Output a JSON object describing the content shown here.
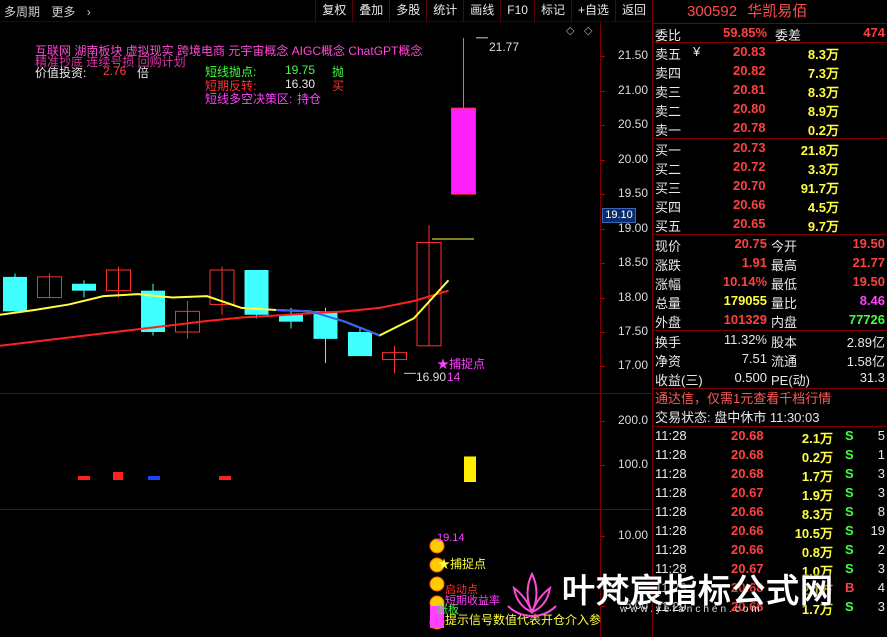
{
  "toolbar": {
    "period": "多周期",
    "more": "更多",
    "buttons": [
      "复权",
      "叠加",
      "多股",
      "统计",
      "画线",
      "F10",
      "标记",
      "+自选",
      "返回"
    ]
  },
  "overlay": {
    "concepts": "互联网    湖南板块    虚拟现实 跨境电商 元宇宙概念 AIGC概念 ChatGPT概念",
    "garbled_line": "精准抄底 连续号损 回购计划",
    "value_invest_label": "价值投资:",
    "value_invest_value": "2.76",
    "value_invest_unit": "倍",
    "short_sell_label": "短线抛点:",
    "short_sell_value": "19.75",
    "short_sell_tag": "抛",
    "short_reverse_label": "短期反转:",
    "short_reverse_value": "16.30",
    "short_reverse_tag": "买",
    "decision_label": "短线多空决策区:",
    "decision_value": "持仓",
    "high_mark": "21.77",
    "low_mark": "16.90",
    "capture_label": "捕捉点",
    "capture_value": "14",
    "price_tag": "19.10"
  },
  "axes": {
    "main_ticks": [
      "21.50",
      "21.00",
      "20.50",
      "20.00",
      "19.50",
      "19.00",
      "18.50",
      "18.00",
      "17.50",
      "17.00"
    ],
    "vol_ticks": [
      "200.0",
      "100.0"
    ],
    "sig_ticks": [
      "10.00",
      "5.00"
    ]
  },
  "signal_pane": {
    "value": "19.14",
    "capture_label": "捕捉点",
    "item2": "启动点",
    "item3": "短期收益率",
    "item4": "涨板",
    "hint": "提示信号数值代表开仓介入参"
  },
  "chart_data": {
    "type": "candlestick",
    "ylim": [
      16.6,
      22.0
    ],
    "candles": [
      {
        "o": 18.3,
        "c": 17.8,
        "h": 18.35,
        "l": 17.8
      },
      {
        "o": 18.0,
        "c": 18.3,
        "h": 18.35,
        "l": 18.0
      },
      {
        "o": 18.2,
        "c": 18.1,
        "h": 18.25,
        "l": 18.0
      },
      {
        "o": 18.1,
        "c": 18.4,
        "h": 18.45,
        "l": 18.0
      },
      {
        "o": 18.1,
        "c": 17.5,
        "h": 18.2,
        "l": 17.45
      },
      {
        "o": 17.5,
        "c": 17.8,
        "h": 17.95,
        "l": 17.4
      },
      {
        "o": 17.9,
        "c": 18.4,
        "h": 18.45,
        "l": 17.75
      },
      {
        "o": 18.4,
        "c": 17.75,
        "h": 18.4,
        "l": 17.7
      },
      {
        "o": 17.75,
        "c": 17.65,
        "h": 17.85,
        "l": 17.55
      },
      {
        "o": 17.8,
        "c": 17.4,
        "h": 17.85,
        "l": 17.05
      },
      {
        "o": 17.5,
        "c": 17.15,
        "h": 17.55,
        "l": 17.15
      },
      {
        "o": 17.1,
        "c": 17.2,
        "h": 17.3,
        "l": 16.9
      },
      {
        "o": 17.3,
        "c": 18.8,
        "h": 19.05,
        "l": 17.3
      },
      {
        "o": 19.5,
        "c": 20.75,
        "h": 21.77,
        "l": 19.5
      }
    ],
    "ma_red": [
      17.3,
      17.36,
      17.42,
      17.48,
      17.54,
      17.6,
      17.66,
      17.71,
      17.74,
      17.77,
      17.8,
      17.85,
      17.95,
      18.1
    ],
    "ma_yellow": [
      17.75,
      17.82,
      17.9,
      18.02,
      18.05,
      18.0,
      18.02,
      17.85,
      17.82,
      17.8,
      17.65,
      17.45,
      17.7,
      18.25
    ],
    "vol_marks": [
      {
        "idx": 2,
        "color": "#ff2020",
        "v": 5
      },
      {
        "idx": 3,
        "color": "#ff2020",
        "v": 10
      },
      {
        "idx": 4,
        "color": "#2040ff",
        "v": 5
      },
      {
        "idx": 6,
        "color": "#ff2020",
        "v": 5
      },
      {
        "idx": 13,
        "color": "#ffee00",
        "v": 120
      }
    ],
    "vol_ylim": [
      0,
      260
    ]
  },
  "quote": {
    "code": "300592",
    "name": "华凯易佰",
    "weibi_label": "委比",
    "weibi_value": "59.85%",
    "weicha_label": "委差",
    "weicha_value": "474",
    "asks": [
      {
        "label": "卖五",
        "flag": "¥",
        "price": "20.83",
        "vol": "8.3万"
      },
      {
        "label": "卖四",
        "flag": "",
        "price": "20.82",
        "vol": "7.3万"
      },
      {
        "label": "卖三",
        "flag": "",
        "price": "20.81",
        "vol": "8.3万"
      },
      {
        "label": "卖二",
        "flag": "",
        "price": "20.80",
        "vol": "8.9万"
      },
      {
        "label": "卖一",
        "flag": "",
        "price": "20.78",
        "vol": "0.2万"
      }
    ],
    "bids": [
      {
        "label": "买一",
        "price": "20.73",
        "vol": "21.8万"
      },
      {
        "label": "买二",
        "price": "20.72",
        "vol": "3.3万"
      },
      {
        "label": "买三",
        "price": "20.70",
        "vol": "91.7万"
      },
      {
        "label": "买四",
        "price": "20.66",
        "vol": "4.5万"
      },
      {
        "label": "买五",
        "price": "20.65",
        "vol": "9.7万"
      }
    ],
    "stats": [
      {
        "l1": "现价",
        "v1": "20.75",
        "c1": "#ff4040",
        "l2": "今开",
        "v2": "19.50",
        "c2": "#ff4040"
      },
      {
        "l1": "涨跌",
        "v1": "1.91",
        "c1": "#ff4040",
        "l2": "最高",
        "v2": "21.77",
        "c2": "#ff4040"
      },
      {
        "l1": "涨幅",
        "v1": "10.14%",
        "c1": "#ff4040",
        "l2": "最低",
        "v2": "19.50",
        "c2": "#ff4040"
      },
      {
        "l1": "总量",
        "v1": "179055",
        "c1": "#ffff40",
        "l2": "量比",
        "v2": "8.46",
        "c2": "#ff40ff"
      },
      {
        "l1": "外盘",
        "v1": "101329",
        "c1": "#ff4040",
        "l2": "内盘",
        "v2": "77726",
        "c2": "#40ff40"
      }
    ],
    "stats2": [
      {
        "l1": "换手",
        "v1": "11.32%",
        "l2": "股本",
        "v2": "2.89亿"
      },
      {
        "l1": "净资",
        "v1": "7.51",
        "l2": "流通",
        "v2": "1.58亿"
      },
      {
        "l1": "收益(三)",
        "v1": "0.500",
        "l2": "PE(动)",
        "v2": "31.3"
      }
    ],
    "ad": "通达信，仅需1元查看千档行情",
    "status": "交易状态: 盘中休市 11:30:03",
    "ticks": [
      {
        "t": "11:28",
        "p": "20.68",
        "v": "2.1万",
        "s": "S",
        "n": "5"
      },
      {
        "t": "11:28",
        "p": "20.68",
        "v": "0.2万",
        "s": "S",
        "n": "1"
      },
      {
        "t": "11:28",
        "p": "20.68",
        "v": "1.7万",
        "s": "S",
        "n": "3"
      },
      {
        "t": "11:28",
        "p": "20.67",
        "v": "1.9万",
        "s": "S",
        "n": "3"
      },
      {
        "t": "11:28",
        "p": "20.66",
        "v": "8.3万",
        "s": "S",
        "n": "8"
      },
      {
        "t": "11:28",
        "p": "20.66",
        "v": "10.5万",
        "s": "S",
        "n": "19"
      },
      {
        "t": "11:28",
        "p": "20.66",
        "v": "0.8万",
        "s": "S",
        "n": "2"
      },
      {
        "t": "11:28",
        "p": "20.67",
        "v": "1.0万",
        "s": "S",
        "n": "3"
      },
      {
        "t": "11:29",
        "p": "20.68",
        "v": "2.1万",
        "s": "B",
        "n": "4"
      },
      {
        "t": "11:29",
        "p": "20.68",
        "v": "1.7万",
        "s": "S",
        "n": "3"
      }
    ]
  },
  "watermark": {
    "text": "叶梵宸指标公式网",
    "url": "www.yefanchen.com"
  }
}
